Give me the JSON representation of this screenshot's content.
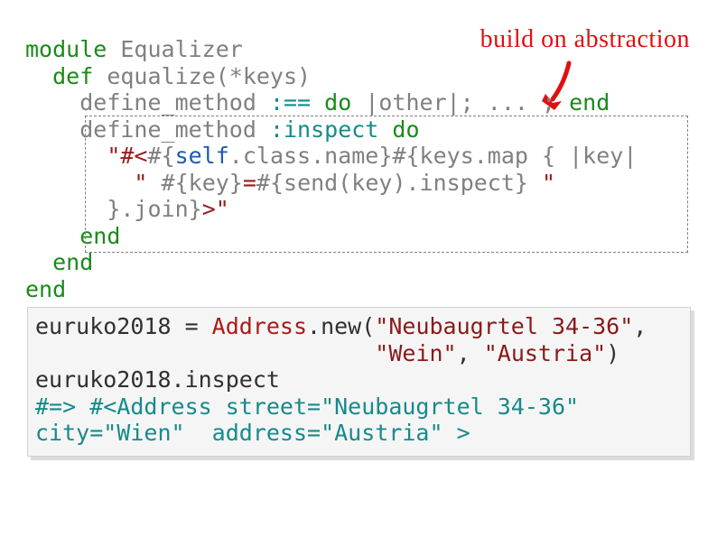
{
  "annotation": "build on abstraction",
  "code": {
    "l1": {
      "t1": "module",
      "t2": " Equalizer"
    },
    "l2": {
      "indent": "  ",
      "t1": "def",
      "t2": " equalize(*keys)"
    },
    "l3": {
      "indent": "    ",
      "t1": "define_method ",
      "t2": ":==",
      "t3": " ",
      "t4": "do",
      "t5": " |other|; ... ; ",
      "t6": "end"
    },
    "l4": {
      "indent": "    ",
      "t1": "define_method ",
      "t2": ":inspect",
      "t3": " ",
      "t4": "do"
    },
    "l5": {
      "indent": "      ",
      "t1": "\"#<",
      "t2": "#{",
      "t3": "self",
      "t4": ".class.name",
      "t5": "}",
      "t6": "#{",
      "t7": "keys.map { |key|"
    },
    "l6": {
      "indent": "        ",
      "t1": "\" ",
      "t2": "#{",
      "t3": "key",
      "t4": "}",
      "t5": "=",
      "t6": "#{",
      "t7": "send(key).inspect",
      "t8": "}",
      "t9": " \""
    },
    "l7": {
      "indent": "      ",
      "t1": "}",
      "t2": ".join",
      "t3": "}",
      "t4": ">\""
    },
    "l8": {
      "indent": "    ",
      "t1": "end"
    },
    "l9": {
      "indent": "  ",
      "t1": "end"
    },
    "l10": {
      "t1": "end"
    }
  },
  "output": {
    "l1": {
      "t1": "euruko2018 = ",
      "t2": "Address",
      "t3": ".new(",
      "t4": "\"Neubaugrtel 34-36\"",
      "t5": ","
    },
    "l2": {
      "indent": "                         ",
      "t1": "\"Wein\"",
      "t2": ", ",
      "t3": "\"Austria\"",
      "t4": ")"
    },
    "l3": {
      "t1": "euruko2018.inspect"
    },
    "l4": {
      "t1": "#=> #<Address street=\"Neubaugrtel 34-36\""
    },
    "l5": {
      "t1": "city=\"Wien\"  address=\"Austria\" >"
    }
  }
}
